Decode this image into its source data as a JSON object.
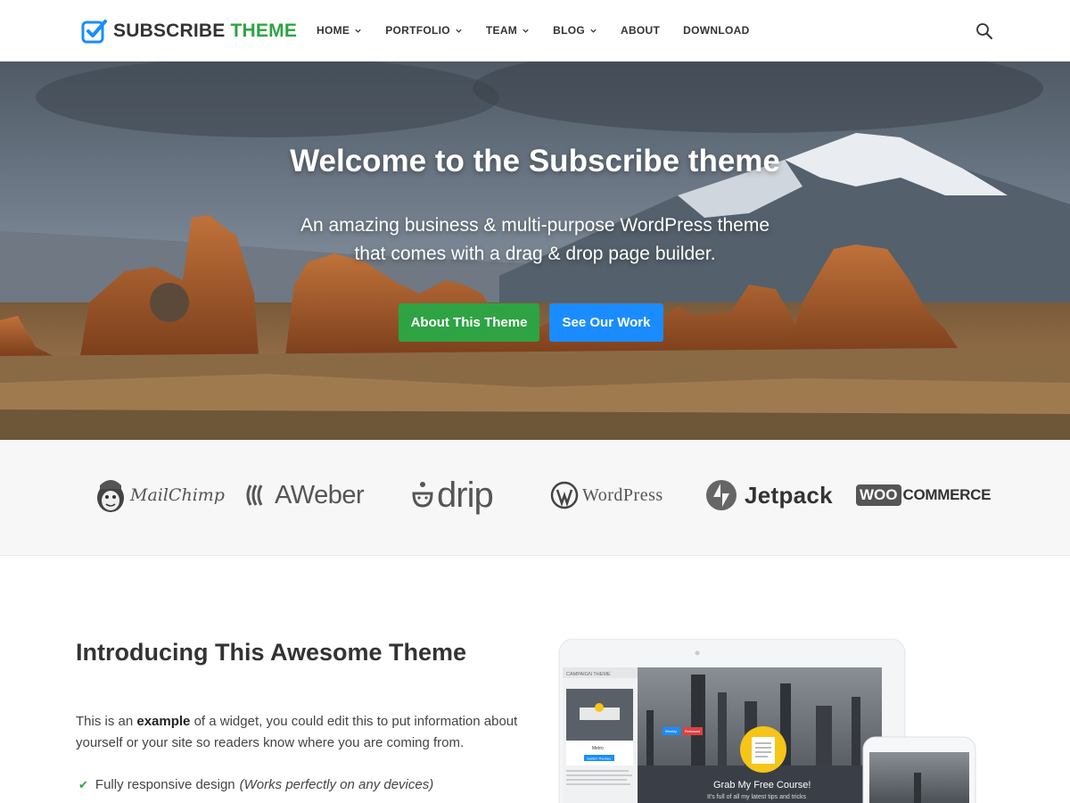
{
  "brand": {
    "name_part1": "SUBSCRIBE",
    "name_part2": "THEME",
    "accent": "#2ea343",
    "logo_icon": "checkbox-icon"
  },
  "nav": {
    "items": [
      {
        "label": "HOME",
        "has_dropdown": true
      },
      {
        "label": "PORTFOLIO",
        "has_dropdown": true
      },
      {
        "label": "TEAM",
        "has_dropdown": true
      },
      {
        "label": "BLOG",
        "has_dropdown": true
      },
      {
        "label": "ABOUT",
        "has_dropdown": false
      },
      {
        "label": "DOWNLOAD",
        "has_dropdown": false
      }
    ],
    "search_icon": "search-icon"
  },
  "hero": {
    "title": "Welcome to the Subscribe theme",
    "subtitle_line1": "An amazing business & multi-purpose WordPress theme",
    "subtitle_line2": "that comes with a drag & drop page builder.",
    "primary_button": "About This Theme",
    "secondary_button": "See Our Work",
    "primary_color": "#2ea343",
    "secondary_color": "#1a8cff"
  },
  "partners": {
    "mailchimp": "MailChimp",
    "aweber": "AWeber",
    "drip": "drip",
    "wordpress": "WordPress",
    "jetpack": "Jetpack",
    "woo_part1": "WOO",
    "woo_part2": "COMMERCE"
  },
  "intro": {
    "title": "Introducing This Awesome Theme",
    "text_before": "This is an ",
    "text_bold": "example",
    "text_after": " of a widget, you could edit this to put information about yourself or your site so readers know where you are coming from.",
    "feature_1": "Fully responsive design",
    "feature_1_note": "(Works perfectly on any devices)"
  },
  "mockup": {
    "sidebar_title": "CAMPAIGN THEME",
    "sidebar_item": "Metro",
    "sidebar_button": "Switch Themes",
    "tag_1": "Weekly",
    "tag_2": "Released",
    "cta_title": "Grab My Free Course!",
    "cta_sub": "It's full of all my latest tips and tricks"
  }
}
